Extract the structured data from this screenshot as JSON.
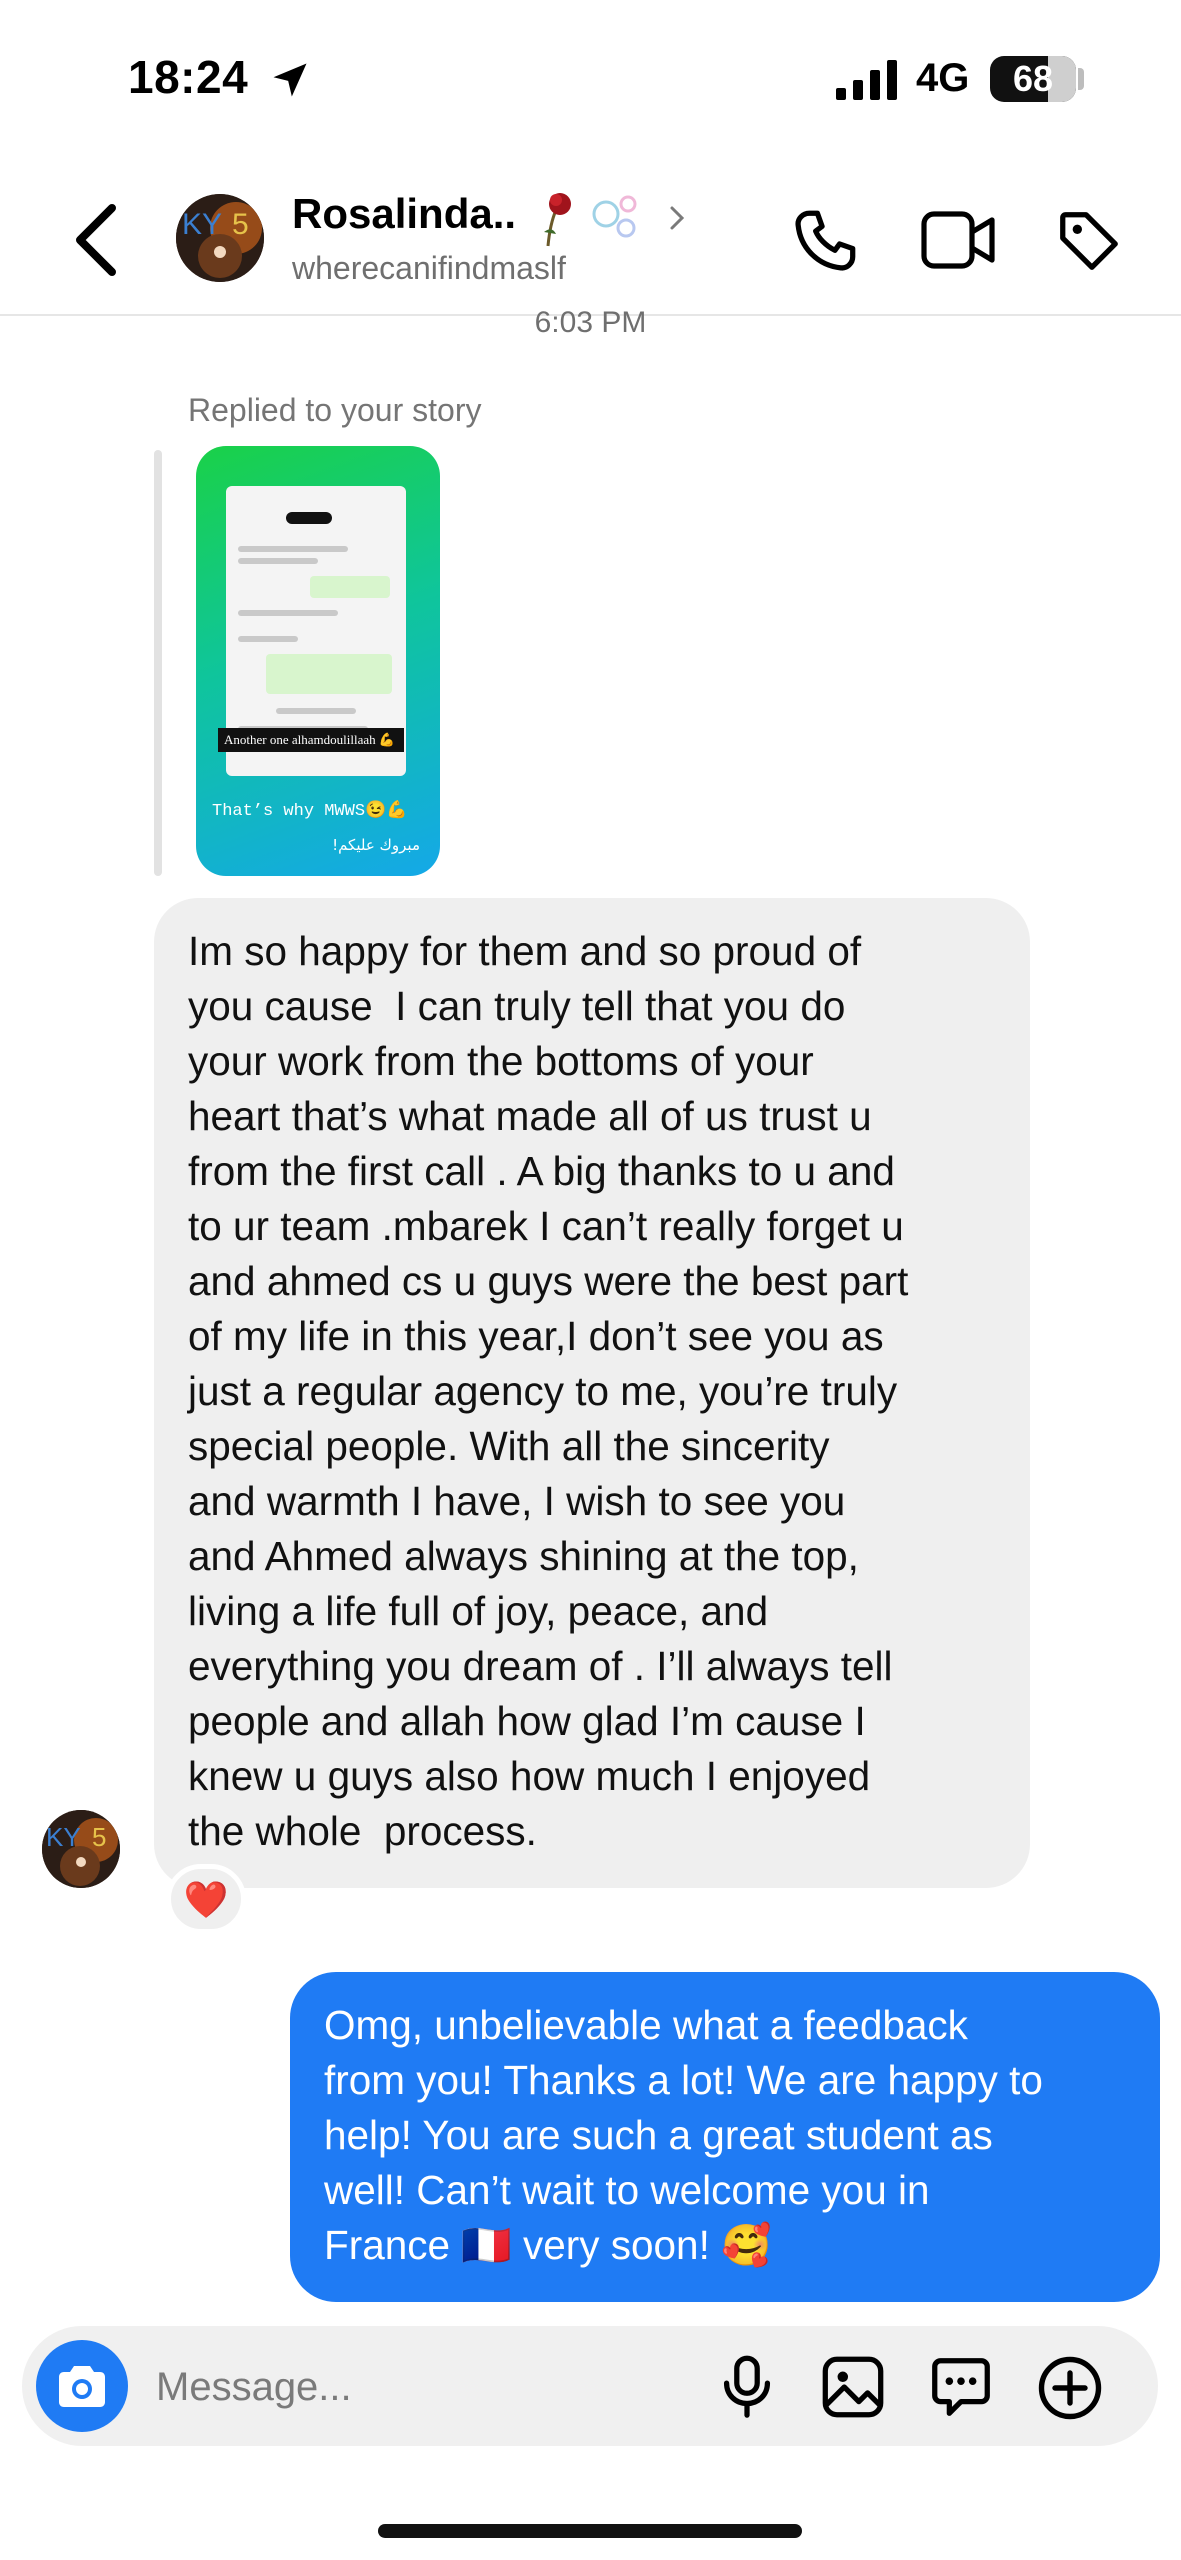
{
  "status_bar": {
    "time": "18:24",
    "network": "4G",
    "battery_level": "68",
    "battery_fraction": 0.68,
    "icons": [
      "location-arrow-icon",
      "signal-bars-icon",
      "battery-icon"
    ]
  },
  "header": {
    "name": "Rosalinda..",
    "username": "wherecanifindmaslf",
    "actions": [
      "back-icon",
      "phone-icon",
      "video-camera-icon",
      "tag-icon"
    ]
  },
  "chat": {
    "timestamp": "6:03 PM",
    "reply_note": "Replied to your story",
    "story": {
      "caption": "Another one alhamdoulillaah 💪",
      "text_line1": "That’s why MWWS😉💪",
      "text_line2": "مبروك عليكم!"
    },
    "incoming_message": "Im so happy for them and so proud of\nyou cause  I can truly tell that you do\nyour work from the bottoms of your\nheart that’s what made all of us trust u\nfrom the first call . A big thanks to u and\nto ur team .mbarek I can’t really forget u\nand ahmed cs u guys were the best part\nof my life in this year,I don’t see you as\njust a regular agency to me, you’re truly\nspecial people. With all the sincerity\nand warmth I have, I wish to see you\nand Ahmed always shining at the top,\nliving a life full of joy, peace, and\neverything you dream of . I’ll always tell\npeople and allah how glad I’m cause I\nknew u guys also how much I enjoyed\nthe whole  process.",
    "reaction": "❤️",
    "outgoing_message": "Omg, unbelievable what a feedback\nfrom you! Thanks a lot! We are happy to\nhelp! You are such a great student as\nwell! Can’t wait to welcome you in\nFrance 🇫🇷 very soon! 🥰"
  },
  "composer": {
    "placeholder": "Message...",
    "value": "",
    "icons": [
      "camera-icon",
      "microphone-icon",
      "image-icon",
      "sticker-icon",
      "plus-icon"
    ]
  },
  "colors": {
    "accent": "#1f7bf4",
    "incoming_bubble": "#efefef",
    "muted_text": "#6f6f6f"
  }
}
